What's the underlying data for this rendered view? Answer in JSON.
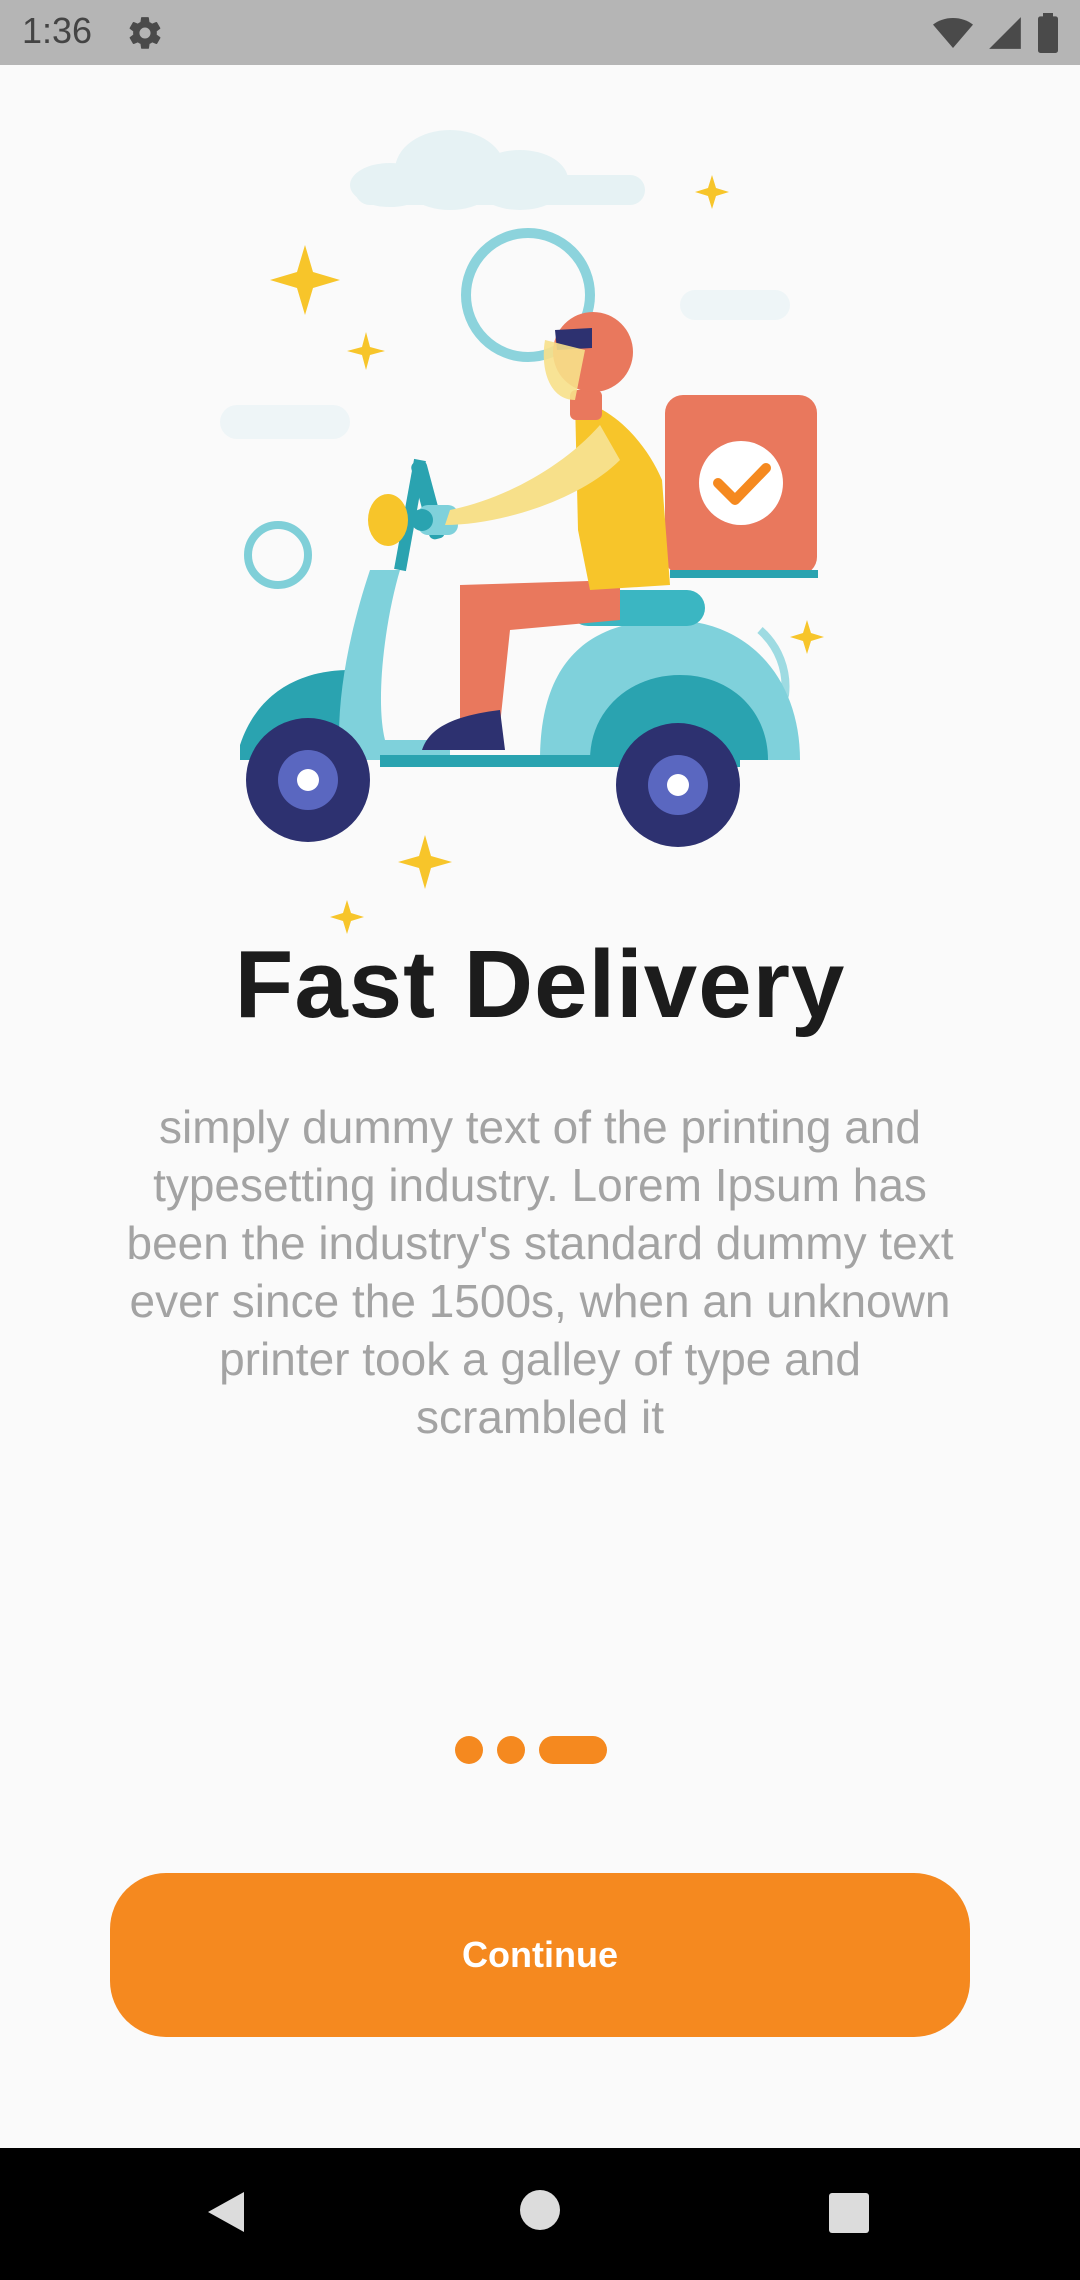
{
  "status_bar": {
    "time": "1:36",
    "icons": [
      "gear-icon",
      "wifi-icon",
      "signal-icon",
      "battery-icon"
    ]
  },
  "onboarding": {
    "illustration": "delivery-scooter-illustration",
    "title": "Fast Delivery",
    "description": "simply dummy text of the printing and typesetting industry. Lorem Ipsum has been the industry's standard dummy text ever since the 1500s, when an unknown printer took a galley of type and scrambled it",
    "page_indicator": {
      "total": 3,
      "current": 3
    },
    "continue_label": "Continue"
  },
  "nav_bar": {
    "icons": [
      "back-icon",
      "home-icon",
      "recents-icon"
    ]
  },
  "colors": {
    "accent": "#f5891f",
    "title": "#1c1c1c",
    "body_text": "#a3a3a3",
    "background": "#fafafa"
  }
}
